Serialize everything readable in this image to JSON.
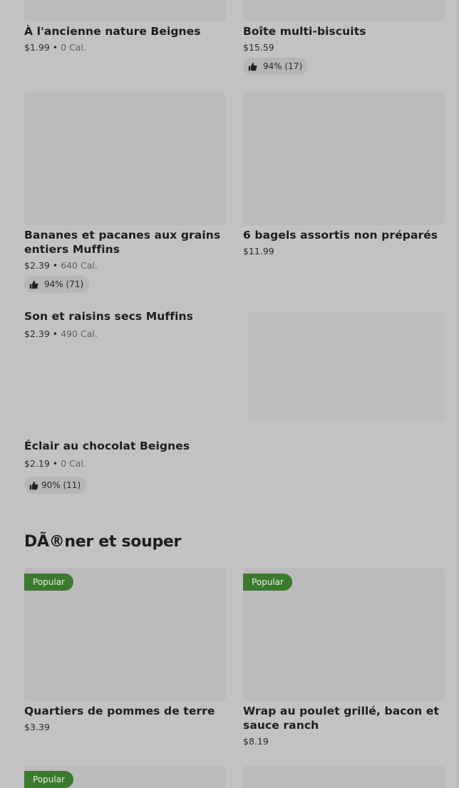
{
  "items": [
    {
      "name": "À l'ancienne nature Beignes",
      "price": "$1.99",
      "cal": "0 Cal."
    },
    {
      "name": "Boîte multi-biscuits",
      "price": "$15.59",
      "rating": "94% (17)"
    },
    {
      "name": "Bananes et pacanes aux grains entiers Muffins",
      "price": "$2.39",
      "cal": "640 Cal.",
      "rating": "94% (71)"
    },
    {
      "name": "6 bagels assortis non préparés",
      "price": "$11.99"
    },
    {
      "name": "Son et raisins secs Muffins",
      "price": "$2.39",
      "cal": "490 Cal."
    },
    {
      "name": "Éclair au chocolat Beignes",
      "price": "$2.19",
      "cal": "0 Cal.",
      "rating": "90% (11)"
    },
    {
      "name": "Quartiers de pommes de terre",
      "price": "$3.39",
      "badge": "Popular"
    },
    {
      "name": "Wrap au poulet grillé, bacon et sauce ranch",
      "price": "$8.19",
      "badge": "Popular"
    },
    {
      "badge": "Popular"
    }
  ],
  "sections": {
    "lunch_dinner": "DÃ®ner et souper"
  },
  "separator": "•",
  "icons": {
    "rating": "thumbs-up-icon"
  }
}
